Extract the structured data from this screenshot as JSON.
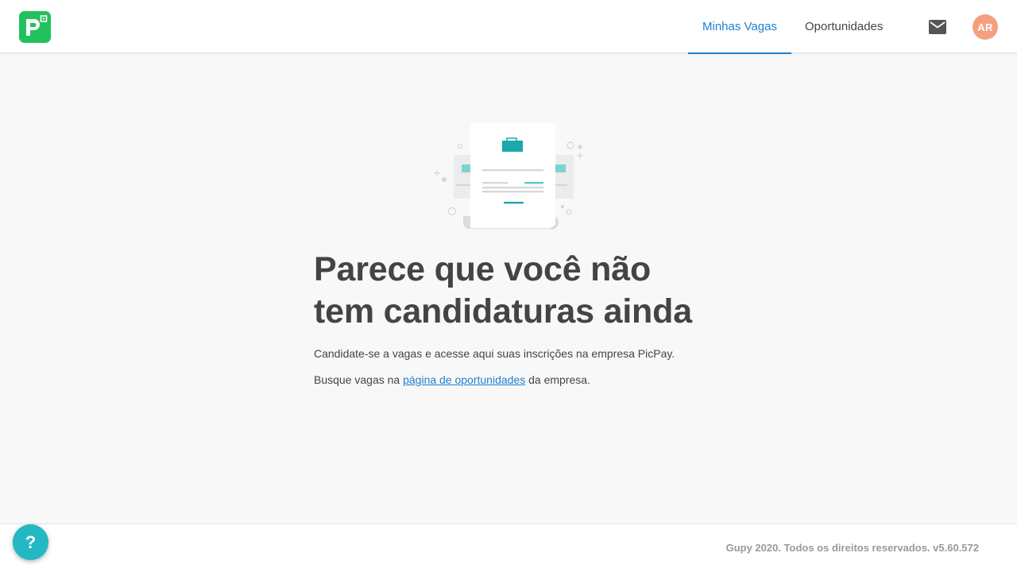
{
  "header": {
    "logo_name": "picpay-logo",
    "tabs": [
      {
        "label": "Minhas Vagas",
        "active": true
      },
      {
        "label": "Oportunidades",
        "active": false
      }
    ],
    "mail_icon": "mail-icon",
    "avatar_initials": "AR",
    "avatar_color": "#f4a07f"
  },
  "main": {
    "illustration_icon": "empty-applications-illustration",
    "title_line1": "Parece que você não",
    "title_line2": "tem candidaturas ainda",
    "description": "Candidate-se a vagas e acesse aqui suas inscrições na empresa PicPay.",
    "search_prefix": "Busque vagas na",
    "search_link": "página de oportunidades",
    "search_suffix": "da empresa."
  },
  "footer": {
    "text": "Gupy 2020. Todos os direitos reservados. v5.60.572"
  },
  "help_button": {
    "label": "?",
    "color": "#23b8c4"
  },
  "colors": {
    "brand_green": "#21c25e",
    "accent_blue": "#1f7fcf",
    "teal": "#1aa8ad"
  }
}
